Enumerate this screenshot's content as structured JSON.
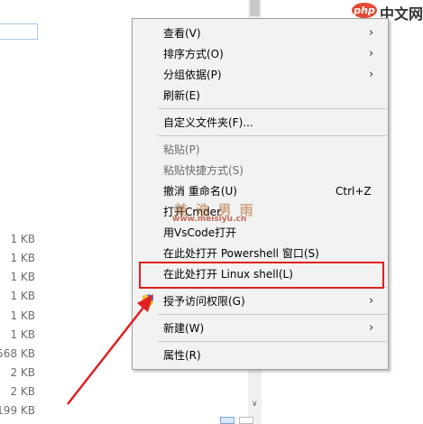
{
  "watermark": {
    "logo": "php",
    "site": "中文网",
    "overlay_text": "美 浩 男 雨",
    "overlay_url": "www.meisiyu.cn"
  },
  "explorer": {
    "file_sizes": [
      "1 KB",
      "1 KB",
      "1 KB",
      "1 KB",
      "1 KB",
      "1 KB",
      "568 KB",
      "2 KB",
      "2 KB",
      "199 KB"
    ]
  },
  "menu": {
    "view": "查看(V)",
    "sort_by": "排序方式(O)",
    "group_by": "分组依据(P)",
    "refresh": "刷新(E)",
    "customize_folder": "自定义文件夹(F)...",
    "paste": "粘贴(P)",
    "paste_shortcut": "粘贴快捷方式(S)",
    "undo_rename": "撤消 重命名(U)",
    "undo_shortcut": "Ctrl+Z",
    "open_cmder": "打开Cmder",
    "open_vscode": "用VsCode打开",
    "open_powershell": "在此处打开 Powershell 窗口(S)",
    "open_linux_shell": "在此处打开 Linux shell(L)",
    "grant_access": "授予访问权限(G)",
    "new": "新建(W)",
    "properties": "属性(R)"
  },
  "colors": {
    "highlight_red": "#e02020",
    "menu_bg": "#f2f2f2"
  }
}
